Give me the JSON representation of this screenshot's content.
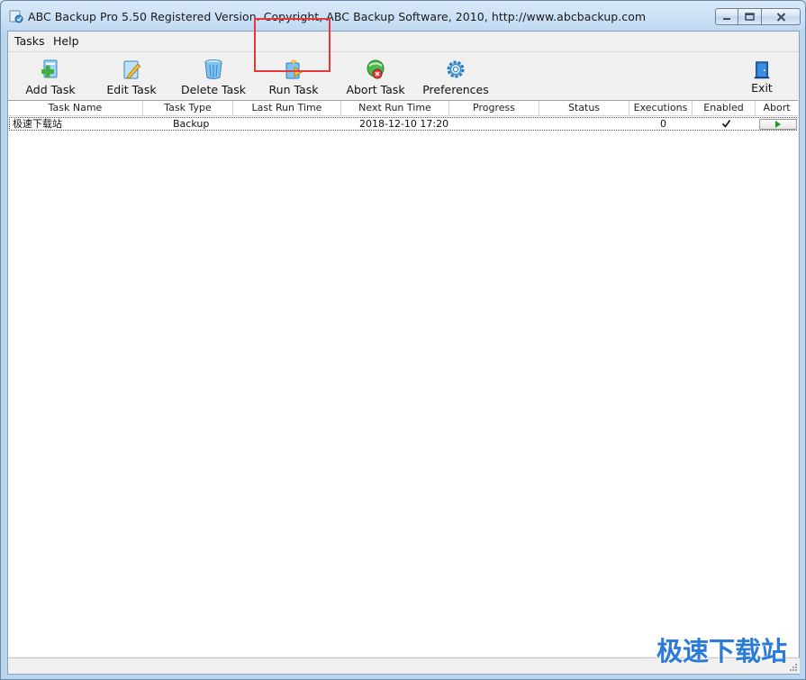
{
  "window": {
    "title": "ABC Backup Pro 5.50   Registered Version.  Copyright,  ABC Backup Software, 2010,    http://www.abcbackup.com"
  },
  "menu": {
    "items": [
      "Tasks",
      "Help"
    ]
  },
  "toolbar": {
    "buttons": [
      {
        "label": "Add Task",
        "icon": "add-task-icon"
      },
      {
        "label": "Edit Task",
        "icon": "edit-task-icon"
      },
      {
        "label": "Delete Task",
        "icon": "delete-task-icon"
      },
      {
        "label": "Run Task",
        "icon": "run-task-icon"
      },
      {
        "label": "Abort Task",
        "icon": "abort-task-icon"
      },
      {
        "label": "Preferences",
        "icon": "preferences-icon"
      },
      {
        "label": "Exit",
        "icon": "exit-icon"
      }
    ],
    "highlighted": "Run Task",
    "highlight_color": "#e53935"
  },
  "table": {
    "columns": [
      "Task Name",
      "Task Type",
      "Last Run Time",
      "Next Run Time",
      "Progress",
      "Status",
      "Executions",
      "Enabled",
      "Abort"
    ],
    "rows": [
      {
        "task_name": "极速下载站",
        "task_type": "Backup",
        "last_run_time": "",
        "next_run_time": "2018-12-10 17:20",
        "progress": "",
        "status": "",
        "executions": "0",
        "enabled": true,
        "abort": "play-icon"
      }
    ]
  },
  "watermark": "极速下载站",
  "colors": {
    "accent": "#2c7bd6",
    "window_frame": "#c3dbf3"
  }
}
